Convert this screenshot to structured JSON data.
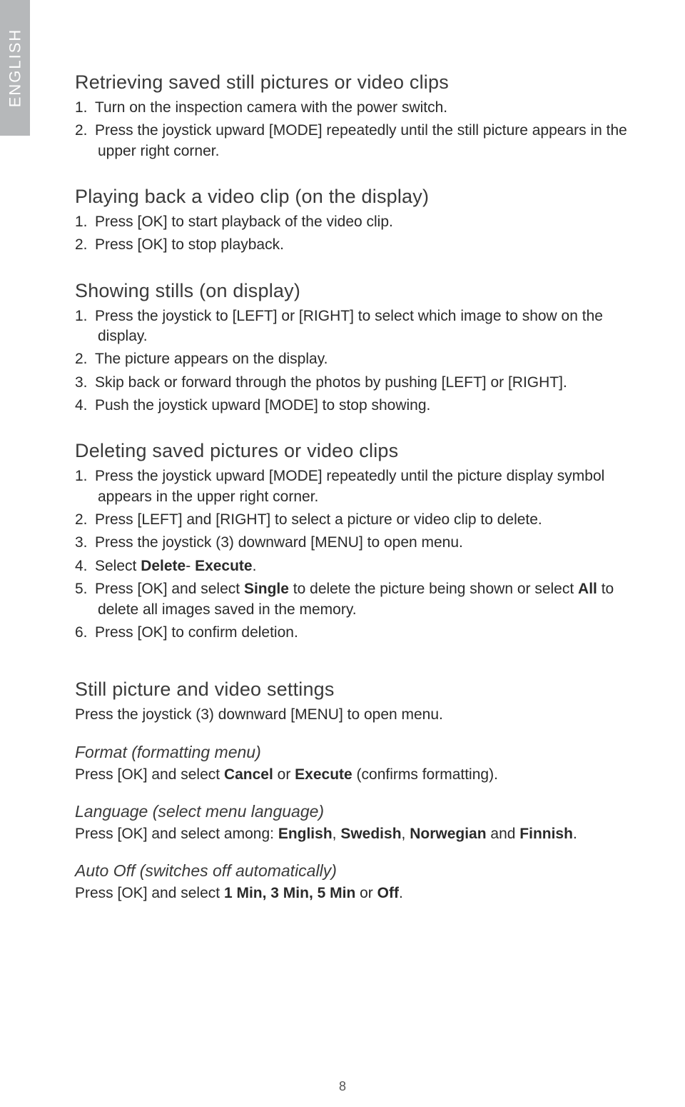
{
  "sideTab": "ENGLISH",
  "pageNumber": "8",
  "s1": {
    "title": "Retrieving saved still pictures or video clips",
    "i1": "Turn on the inspection camera with the power switch.",
    "i2": "Press the joystick upward [MODE] repeatedly until the still picture appears in the upper right corner."
  },
  "s2": {
    "title": "Playing back a video clip (on the display)",
    "i1": "Press [OK] to start playback of the video clip.",
    "i2": "Press [OK] to stop playback."
  },
  "s3": {
    "title": "Showing stills  (on display)",
    "i1": "Press the joystick to [LEFT] or [RIGHT] to select which image to show on the display.",
    "i2": "The picture appears on the display.",
    "i3": "Skip back or forward through the photos by pushing [LEFT] or [RIGHT].",
    "i4": "Push the joystick upward [MODE] to stop showing."
  },
  "s4": {
    "title": "Deleting saved pictures or video clips",
    "i1": "Press the joystick upward [MODE] repeatedly until the picture display symbol appears in the upper right corner.",
    "i2": "Press [LEFT] and [RIGHT] to select a picture or video clip to delete.",
    "i3": "Press the joystick (3) downward [MENU] to open menu.",
    "i4a": "Select ",
    "i4b": "Delete",
    "i4c": "- ",
    "i4d": "Execute",
    "i4e": ".",
    "i5a": "Press [OK] and select ",
    "i5b": "Single",
    "i5c": " to delete the picture being shown or select ",
    "i5d": "All",
    "i5e": " to delete all images saved in the memory.",
    "i6": "Press [OK] to confirm deletion."
  },
  "s5": {
    "title": "Still picture and video settings",
    "intro": "Press the joystick (3) downward [MENU] to open menu.",
    "sub1": {
      "title": "Format (formatting menu)",
      "a": "Press [OK] and select ",
      "b": "Cancel",
      "c": " or ",
      "d": "Execute",
      "e": " (confirms formatting)."
    },
    "sub2": {
      "title": "Language (select menu language)",
      "a": "Press [OK] and select among: ",
      "b": "English",
      "c": ", ",
      "d": "Swedish",
      "e": ", ",
      "f": "Norwegian",
      "g": " and ",
      "h": "Finnish",
      "i": "."
    },
    "sub3": {
      "title": "Auto Off (switches off automatically)",
      "a": "Press [OK] and select ",
      "b": "1 Min, 3 Min, 5 Min",
      "c": " or ",
      "d": "Off",
      "e": "."
    }
  }
}
